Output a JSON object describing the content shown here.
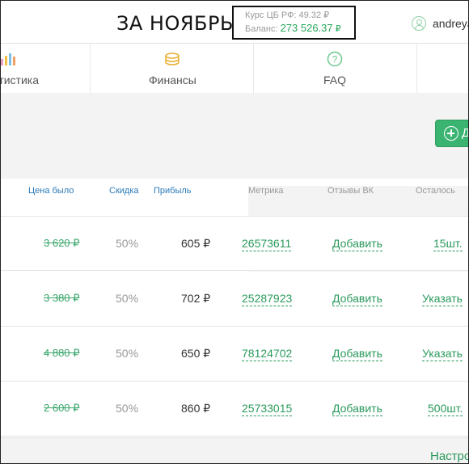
{
  "header": {
    "month_title": "ЗА НОЯБРЬ",
    "rate_label": "Курс ЦБ РФ: 49.32 ₽",
    "balance_label": "Баланс:",
    "balance_value": "273 526.37",
    "balance_currency": "₽",
    "username": "andreya"
  },
  "nav": {
    "items": [
      {
        "label": "тистика",
        "icon": "bar-chart-icon"
      },
      {
        "label": "Финансы",
        "icon": "coins-icon"
      },
      {
        "label": "FAQ",
        "icon": "question-icon"
      }
    ]
  },
  "actions": {
    "add_label": "Д"
  },
  "table": {
    "headers": [
      "Цена было",
      "Скидка",
      "Прибыль",
      "Метрика",
      "Отзывы ВК",
      "Осталось"
    ],
    "rows": [
      {
        "old_price": "3 620 ₽",
        "discount": "50%",
        "profit": "605 ₽",
        "metric": "26573611",
        "vk": "Добавить",
        "left": "15шт."
      },
      {
        "old_price": "3 380 ₽",
        "discount": "50%",
        "profit": "702 ₽",
        "metric": "25287923",
        "vk": "Добавить",
        "left": "Указать"
      },
      {
        "old_price": "4 880 ₽",
        "discount": "50%",
        "profit": "650 ₽",
        "metric": "78124702",
        "vk": "Добавить",
        "left": "Указать"
      },
      {
        "old_price": "2 600 ₽",
        "discount": "50%",
        "profit": "860 ₽",
        "metric": "25733015",
        "vk": "Добавить",
        "left": "500шт."
      }
    ]
  },
  "footer": {
    "settings_label": "Настро"
  },
  "colors": {
    "accent_green": "#3bb371",
    "link_blue": "#2a7ab8"
  }
}
